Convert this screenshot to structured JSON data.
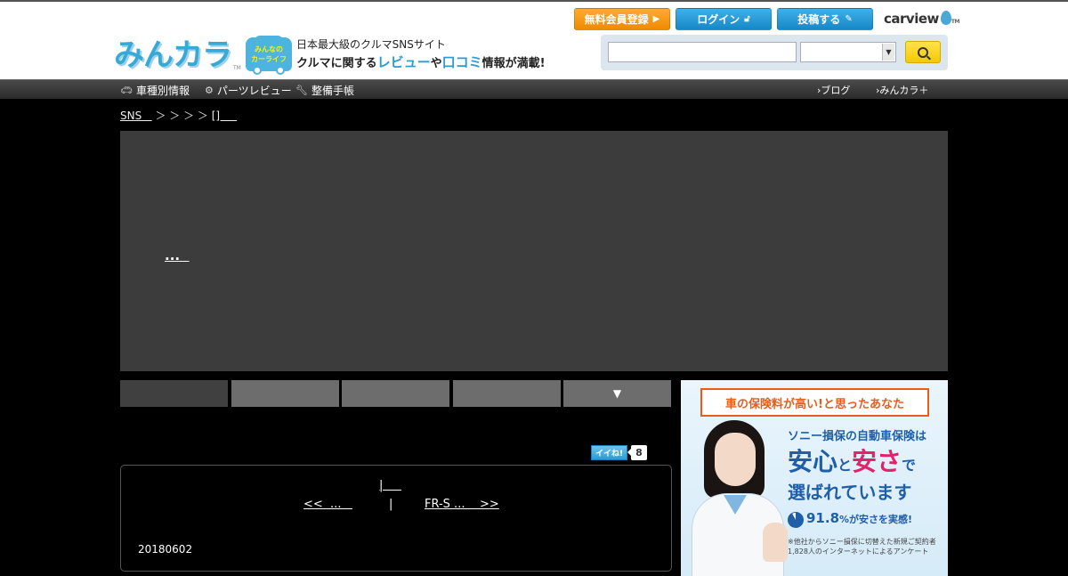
{
  "header": {
    "logo_text": "みんカラ",
    "logo_tm": "TM",
    "badge_line1": "みんなの",
    "badge_line2": "カーライフ",
    "tagline1": "日本最大級のクルマSNSサイト",
    "tagline2_a": "クルマに関する",
    "tagline2_b": "レビュー",
    "tagline2_c": "や",
    "tagline2_d": "口コミ",
    "tagline2_e": "情報が満載!",
    "register_label": "無料会員登録",
    "login_label": "ログイン",
    "post_label": "投稿する",
    "carview_label": "carview",
    "carview_tm": "TM",
    "search_value": "",
    "search_select_value": ""
  },
  "nav": {
    "items": [
      {
        "label": "車種別情報",
        "icon": "car-icon"
      },
      {
        "label": "パーツレビュー",
        "icon": "gear-icon"
      },
      {
        "label": "整備手帳",
        "icon": "wrench-icon"
      }
    ],
    "right_items": [
      "ブログ",
      "みんカラ＋"
    ]
  },
  "breadcrumb": {
    "root": "SNS   ",
    "separators": " ＞ ＞ ＞ ＞ ",
    "current": "[]     "
  },
  "banner": {
    "title": "...  "
  },
  "tabs": [
    "",
    "",
    "",
    "",
    "▼"
  ],
  "like": {
    "label": "イイね!",
    "count": "8"
  },
  "panel": {
    "top_link": "|     ",
    "prev_link": "<<  ...   ",
    "middle": "|",
    "next_link": "FR-S ...    >>",
    "date": "20180602"
  },
  "ad": {
    "headline": "車の保険料が高い!と思ったあなた",
    "line1": "ソニー損保の自動車保険は",
    "line2_a": "安心",
    "line2_b": "と",
    "line2_c": "安さ",
    "line2_d": "で",
    "line3": "選ばれています",
    "stat_value": "91.8",
    "stat_suffix": "%が安さを実感!",
    "note": "※他社からソニー損保に切替えた新規ご契約者1,828人のインターネットによるアンケート"
  },
  "colors": {
    "accent_blue": "#2a9bd3",
    "register_orange": "#f08a00",
    "ad_orange": "#e85d1c",
    "ad_blue": "#1e5fa8"
  }
}
